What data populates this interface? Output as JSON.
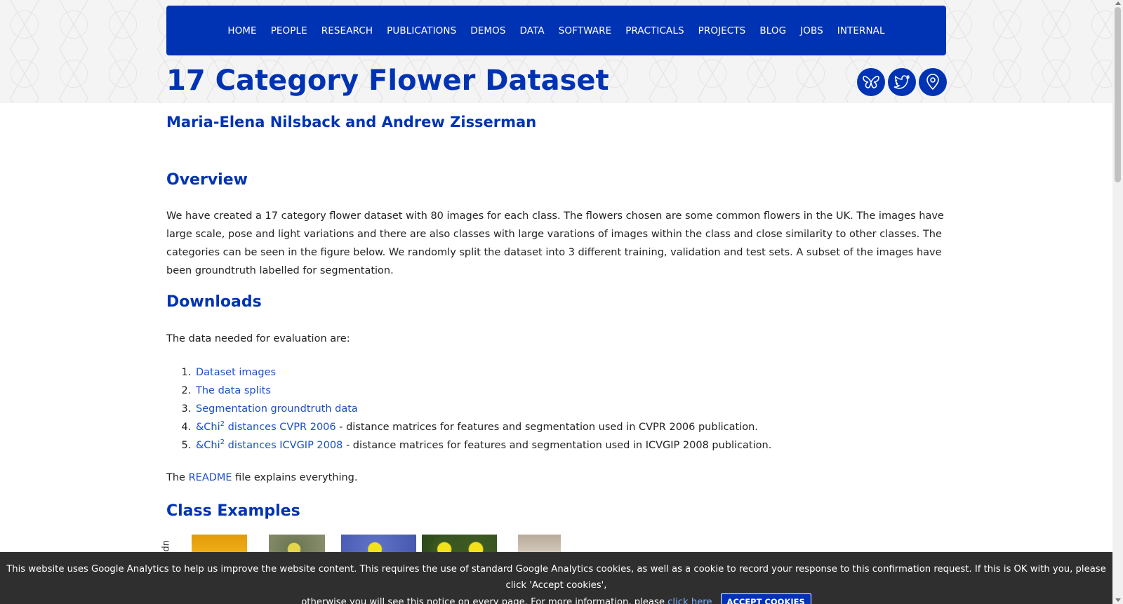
{
  "nav": {
    "items": [
      "HOME",
      "PEOPLE",
      "RESEARCH",
      "PUBLICATIONS",
      "DEMOS",
      "DATA",
      "SOFTWARE",
      "PRACTICALS",
      "PROJECTS",
      "BLOG",
      "JOBS",
      "INTERNAL"
    ]
  },
  "header": {
    "title": "17 Category Flower Dataset",
    "social_icons": [
      "butterfly-icon",
      "twitter-bird-icon",
      "map-pin-icon"
    ]
  },
  "authors": "Maria-Elena Nilsback and Andrew Zisserman",
  "overview": {
    "heading": "Overview",
    "text": "We have created a 17 category flower dataset with 80 images for each class. The flowers chosen are some common flowers in the UK. The images have large scale, pose and light variations and there are also classes with large varations of images within the class and close similarity to other classes. The categories can be seen in the figure below. We randomly split the dataset into 3 different training, validation and test sets. A subset of the images have been groundtruth labelled for segmentation."
  },
  "downloads": {
    "heading": "Downloads",
    "intro": "The data needed for evaluation are:",
    "items": [
      {
        "link": "Dataset images",
        "rest": ""
      },
      {
        "link": "The data splits",
        "rest": ""
      },
      {
        "link": "Segmentation groundtruth data",
        "rest": ""
      },
      {
        "link_pre": "&Chi",
        "sup": "2",
        "link_post": " distances CVPR 2006",
        "rest": " - distance matrices for features and segmentation used in CVPR 2006 publication."
      },
      {
        "link_pre": "&Chi",
        "sup": "2",
        "link_post": " distances ICVGIP 2008",
        "rest": " - distance matrices for features and segmentation used in ICVGIP 2008 publication."
      }
    ],
    "readme_pre": "The ",
    "readme_link": "README",
    "readme_post": " file explains everything."
  },
  "class_examples": {
    "heading": "Class Examples",
    "side_label": "up"
  },
  "cookie": {
    "text1": "This website uses Google Analytics to help us improve the website content. This requires the use of standard Google Analytics cookies, as well as a cookie to record your response to this confirmation request. If this is OK with you, please click 'Accept cookies',",
    "text2": "otherwise you will see this notice on every page. For more information, please ",
    "link": "click here",
    "button": "ACCEPT COOKIES"
  },
  "colors": {
    "brand_blue": "#0033b3",
    "link_blue": "#1a4fc4",
    "cookie_bg": "#2f2f2f"
  }
}
